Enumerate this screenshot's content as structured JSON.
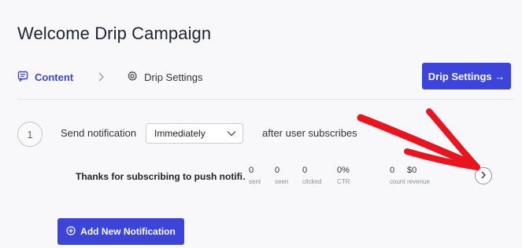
{
  "page": {
    "title": "Welcome Drip Campaign"
  },
  "tabs": [
    {
      "label": "Content",
      "icon": "message-icon",
      "active": true
    },
    {
      "label": "Drip Settings",
      "icon": "gear-icon",
      "active": false
    }
  ],
  "header": {
    "drip_settings_button": "Drip Settings →"
  },
  "step": {
    "number": "1",
    "send_label": "Send notification",
    "timing_select": "Immediately",
    "after_label": "after user subscribes"
  },
  "notification": {
    "title": "Thanks for subscribing to push notifi…",
    "stats": [
      {
        "value": "0",
        "label": "sent"
      },
      {
        "value": "0",
        "label": "seen"
      },
      {
        "value": "0",
        "label": "clicked"
      },
      {
        "value": "0%",
        "label": "CTR"
      },
      {
        "value": "0",
        "label": "count"
      },
      {
        "value": "$0",
        "label": "revenue"
      }
    ]
  },
  "footer": {
    "add_button": "Add New Notification"
  },
  "colors": {
    "accent": "#3c44d9",
    "annotation": "#e8141e"
  }
}
